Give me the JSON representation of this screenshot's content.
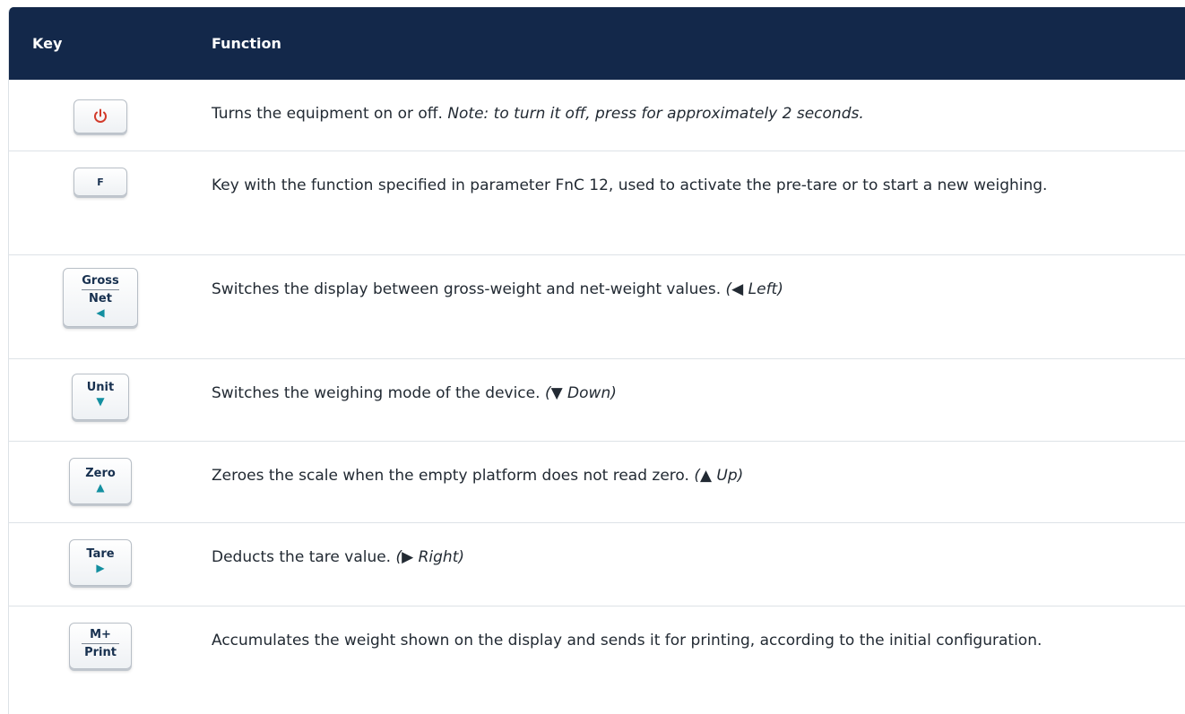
{
  "header": {
    "key": "Key",
    "function": "Function"
  },
  "rows": [
    {
      "key": {
        "icon": "power-icon"
      },
      "text": "Turns the equipment on or off. ",
      "note": "Note: to turn it off, press for approximately 2 seconds."
    },
    {
      "key": {
        "label": "F"
      },
      "text": "Key with the function specified in parameter FnC 12, used to activate the pre-tare or to start a new weighing.",
      "note": ""
    },
    {
      "key": {
        "top": "Gross",
        "bottom": "Net",
        "arrow": "◀"
      },
      "text": "Switches the display between gross-weight and net-weight values. ",
      "note": "(◀ Left)"
    },
    {
      "key": {
        "label": "Unit",
        "arrow": "▼"
      },
      "text": "Switches the weighing mode of the device. ",
      "note": "(▼ Down)"
    },
    {
      "key": {
        "label": "Zero",
        "arrow": "▲"
      },
      "text": "Zeroes the scale when the empty platform does not read zero. ",
      "note": "(▲ Up)"
    },
    {
      "key": {
        "label": "Tare",
        "arrow": "▶"
      },
      "text": "Deducts the tare value. ",
      "note": "(▶ Right)"
    },
    {
      "key": {
        "top": "M+",
        "bottom": "Print"
      },
      "text": "Accumulates the weight shown on the display and sends it for printing, according to the initial configuration.",
      "note": ""
    }
  ],
  "colors": {
    "header_bg": "#13284a",
    "power_icon": "#d23a2a",
    "arrow": "#138fa0"
  }
}
